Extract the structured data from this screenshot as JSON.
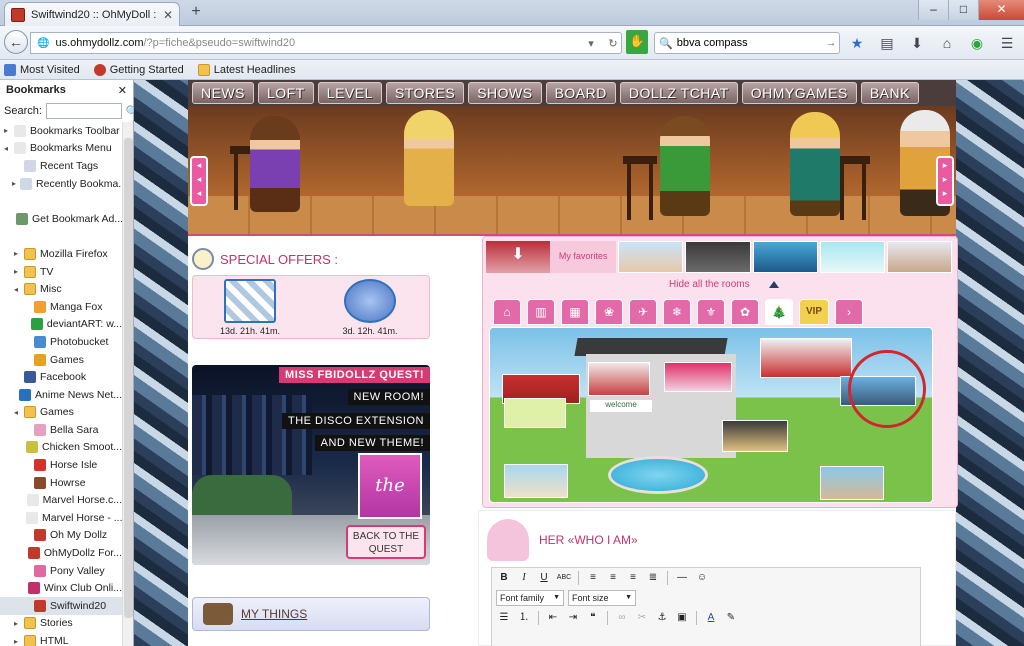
{
  "browser": {
    "tab_title": "Swiftwind20 :: OhMyDoll : ...",
    "new_tab": "+",
    "url_domain": "us.ohmydollz.com",
    "url_path": "/?p=fiche&pseudo=swiftwind20",
    "search_value": "bbva compass",
    "bookmarks_bar": [
      "Most Visited",
      "Getting Started",
      "Latest Headlines"
    ]
  },
  "sidebar": {
    "title": "Bookmarks",
    "search_label": "Search:",
    "items": [
      {
        "label": "Bookmarks Toolbar",
        "depth": 0,
        "twisty": "▸"
      },
      {
        "label": "Bookmarks Menu",
        "depth": 0,
        "twisty": "◂"
      },
      {
        "label": "Recent Tags",
        "depth": 1,
        "twisty": ""
      },
      {
        "label": "Recently Bookma...",
        "depth": 1,
        "twisty": "▸"
      },
      {
        "label": "",
        "depth": 1,
        "twisty": ""
      },
      {
        "label": "Get Bookmark Ad...",
        "depth": 1,
        "twisty": ""
      },
      {
        "label": "",
        "depth": 1,
        "twisty": ""
      },
      {
        "label": "Mozilla Firefox",
        "depth": 1,
        "twisty": "▸"
      },
      {
        "label": "TV",
        "depth": 1,
        "twisty": "▸"
      },
      {
        "label": "Misc",
        "depth": 1,
        "twisty": "◂"
      },
      {
        "label": "Manga Fox",
        "depth": 2,
        "twisty": ""
      },
      {
        "label": "deviantART: w...",
        "depth": 2,
        "twisty": ""
      },
      {
        "label": "Photobucket",
        "depth": 2,
        "twisty": ""
      },
      {
        "label": "Games",
        "depth": 2,
        "twisty": ""
      },
      {
        "label": "Facebook",
        "depth": 1,
        "twisty": ""
      },
      {
        "label": "Anime News Net...",
        "depth": 1,
        "twisty": ""
      },
      {
        "label": "Games",
        "depth": 1,
        "twisty": "◂"
      },
      {
        "label": "Bella Sara",
        "depth": 2,
        "twisty": ""
      },
      {
        "label": "Chicken Smoot...",
        "depth": 2,
        "twisty": ""
      },
      {
        "label": "Horse Isle",
        "depth": 2,
        "twisty": ""
      },
      {
        "label": "Howrse",
        "depth": 2,
        "twisty": ""
      },
      {
        "label": "Marvel Horse.c...",
        "depth": 2,
        "twisty": ""
      },
      {
        "label": "Marvel Horse - ...",
        "depth": 2,
        "twisty": ""
      },
      {
        "label": "Oh My Dollz",
        "depth": 2,
        "twisty": ""
      },
      {
        "label": "OhMyDollz For...",
        "depth": 2,
        "twisty": ""
      },
      {
        "label": "Pony Valley",
        "depth": 2,
        "twisty": ""
      },
      {
        "label": "Winx Club Onli...",
        "depth": 2,
        "twisty": ""
      },
      {
        "label": "Swiftwind20",
        "depth": 2,
        "twisty": "",
        "selected": true
      },
      {
        "label": "Stories",
        "depth": 1,
        "twisty": "▸"
      },
      {
        "label": "HTML",
        "depth": 1,
        "twisty": "▸"
      }
    ]
  },
  "site": {
    "menu": [
      "NEWS",
      "LOFT",
      "LEVEL",
      "STORES",
      "SHOWS",
      "BOARD",
      "DOLLZ TCHAT",
      "OHMYGAMES",
      "BANK"
    ],
    "special_offers_title": "SPECIAL OFFERS :",
    "offers": [
      {
        "timer": "13d. 21h. 41m."
      },
      {
        "timer": "3d. 12h. 41m."
      }
    ],
    "quest": {
      "title": "MISS FBIDOLLZ QUEST!",
      "line1": "NEW ROOM!",
      "line2": "THE DISCO EXTENSION",
      "line3": "AND NEW THEME!",
      "end_text": "the end",
      "back_button": "BACK TO THE QUEST"
    },
    "my_things": "MY THINGS",
    "favorites_label": "My favorites",
    "hide_rooms": "Hide all the rooms",
    "room_tab_vip": "VIP",
    "welcome_sign": "welcome",
    "who_title": "HER «WHO I AM»",
    "editor": {
      "font_family": "Font family",
      "font_size": "Font size"
    }
  }
}
